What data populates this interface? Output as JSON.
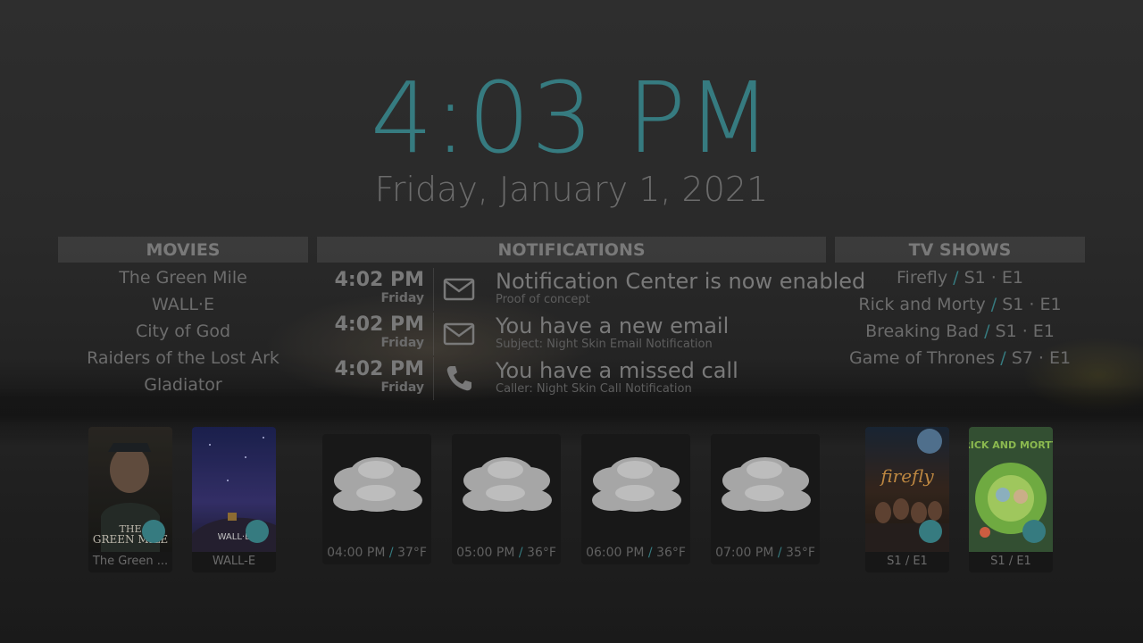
{
  "clock": {
    "time": "4:03 PM",
    "date": "Friday, January 1, 2021"
  },
  "colors": {
    "accent": "#3e8d92",
    "text": "#8a8a8a",
    "panel": "#555555"
  },
  "movies": {
    "header": "MOVIES",
    "items": [
      "The Green Mile",
      "WALL·E",
      "City of God",
      "Raiders of the Lost Ark",
      "Gladiator"
    ],
    "posters": [
      {
        "label": "The Green ...",
        "art": "the-green-mile-poster"
      },
      {
        "label": "WALL-E",
        "art": "wall-e-poster"
      }
    ]
  },
  "notifications": {
    "header": "NOTIFICATIONS",
    "items": [
      {
        "time": "4:02 PM",
        "day": "Friday",
        "icon": "mail-icon",
        "title": "Notification Center is now enabled",
        "subtitle": "Proof of concept"
      },
      {
        "time": "4:02 PM",
        "day": "Friday",
        "icon": "mail-icon",
        "title": "You have a new email",
        "subtitle": "Subject: Night Skin Email Notification"
      },
      {
        "time": "4:02 PM",
        "day": "Friday",
        "icon": "phone-icon",
        "title": "You have a missed call",
        "subtitle": "Caller: Night Skin Call Notification"
      }
    ]
  },
  "weather": {
    "hours": [
      {
        "time": "04:00 PM",
        "sep": " / ",
        "temp": "37°F",
        "icon": "cloud-icon"
      },
      {
        "time": "05:00 PM",
        "sep": " / ",
        "temp": "36°F",
        "icon": "cloud-icon"
      },
      {
        "time": "06:00 PM",
        "sep": " / ",
        "temp": "36°F",
        "icon": "cloud-icon"
      },
      {
        "time": "07:00 PM",
        "sep": " / ",
        "temp": "35°F",
        "icon": "cloud-icon"
      }
    ]
  },
  "tvshows": {
    "header": "TV SHOWS",
    "items": [
      {
        "show": "Firefly",
        "sep": " / ",
        "episode": "S1 · E1"
      },
      {
        "show": "Rick and Morty",
        "sep": " / ",
        "episode": "S1 · E1"
      },
      {
        "show": "Breaking Bad",
        "sep": " / ",
        "episode": "S1 · E1"
      },
      {
        "show": "Game of Thrones",
        "sep": " / ",
        "episode": "S7 · E1"
      }
    ],
    "posters": [
      {
        "label": "S1 / E1",
        "art": "firefly-poster"
      },
      {
        "label": "S1 / E1",
        "art": "rick-and-morty-poster"
      }
    ]
  }
}
